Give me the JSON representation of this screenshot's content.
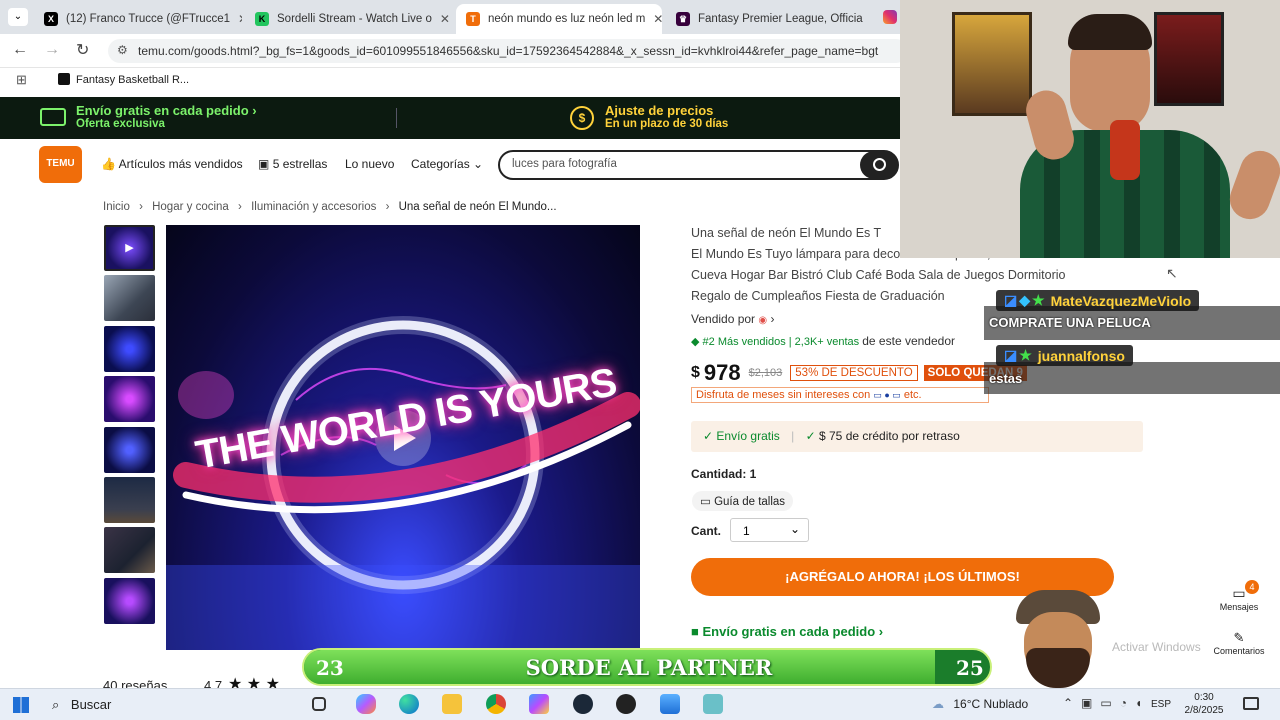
{
  "browser": {
    "tabs": [
      {
        "title": "(12) Franco Trucce (@FTrucce1",
        "icon": "x-icon"
      },
      {
        "title": "Sordelli Stream - Watch Live o",
        "icon": "kick-icon"
      },
      {
        "title": "neón mundo es luz neón led m",
        "icon": "temu-icon",
        "active": true
      },
      {
        "title": "Fantasy Premier League, Officia",
        "icon": "premier-league-icon"
      }
    ],
    "url": "temu.com/goods.html?_bg_fs=1&goods_id=601099551846556&sku_id=17592364542884&_x_sessn_id=kvhklroi44&refer_page_name=bgt",
    "bookmark": "Fantasy Basketball R..."
  },
  "promo": {
    "shipping_title": "Envío gratis en cada pedido",
    "shipping_sub": "Oferta exclusiva",
    "price_title": "Ajuste de precios",
    "price_sub": "En un plazo de 30 días"
  },
  "header": {
    "logo": "TEMU",
    "nav": [
      "Artículos más vendidos",
      "5 estrellas",
      "Lo nuevo",
      "Categorías"
    ],
    "search_placeholder": "luces para fotografía"
  },
  "breadcrumb": [
    "Inicio",
    "Hogar y cocina",
    "Iluminación y accesorios",
    "Una señal de neón El Mundo..."
  ],
  "product": {
    "image_text": "THE WORLD IS YOURS",
    "title_lines": [
      "Una señal de neón El Mundo Es T",
      "El Mundo Es Tuyo lámpara para decoración de pared, Hombre",
      "Cueva Hogar Bar Bistró Club Café Boda Sala de Juegos Dormitorio",
      "Regalo de Cumpleaños Fiesta de Graduación"
    ],
    "sold_by": "Vendido por",
    "bestseller": "#2 Más vendidos | 2,3K+ ventas",
    "bestseller_suffix": "de este vendedor",
    "currency": "$",
    "price": "978",
    "old_price": "$2,103",
    "discount": "53% DE DESCUENTO",
    "stock": "SOLO QUEDAN 9",
    "installments": "Disfruta de meses sin intereses con",
    "installments_suffix": "etc.",
    "free_shipping": "Envío gratis",
    "credit": "$ 75 de crédito por retraso",
    "quantity_label": "Cantidad: 1",
    "size_guide": "Guía de tallas",
    "qty_select_label": "Cant.",
    "qty_value": "1",
    "add_button": "¡AGRÉGALO AHORA! ¡LOS ÚLTIMOS!",
    "shipping_footer": "Envío gratis en cada pedido",
    "reviews": "40 reseñas",
    "rating": "4.7"
  },
  "side": {
    "messages": "Mensajes",
    "messages_badge": "4",
    "comments": "Comentarios"
  },
  "chat": [
    {
      "user": "MateVazquezMeViolo",
      "message": "COMPRATE UNA PELUCA"
    },
    {
      "user": "juannalfonso",
      "message": "estas"
    }
  ],
  "overlay": {
    "left_number": "23",
    "text": "SORDE AL PARTNER",
    "right_number": "25",
    "progress": 0.92
  },
  "watermark": "Activar Windows",
  "taskbar": {
    "search": "Buscar",
    "weather": "16°C  Nublado",
    "lang": "ESP",
    "time": "0:30",
    "date": "2/8/2025"
  },
  "colors": {
    "temu_orange": "#f06d0a",
    "promo_bg": "#0c1a10",
    "promo_green": "#7cf26b",
    "add_button": "#f06d0a",
    "free_shipping_green": "#0a8a2d",
    "discount_red": "#e0500c"
  }
}
